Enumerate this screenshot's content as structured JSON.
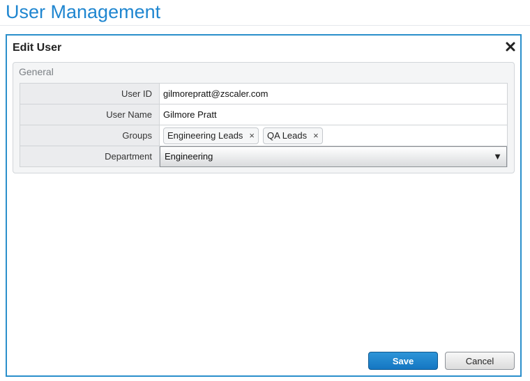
{
  "page": {
    "title": "User Management"
  },
  "dialog": {
    "title": "Edit User",
    "close_icon": "close-x-icon",
    "section": {
      "title": "General",
      "fields": {
        "user_id": {
          "label": "User ID",
          "value": "gilmorepratt@zscaler.com"
        },
        "user_name": {
          "label": "User Name",
          "value": "Gilmore Pratt"
        },
        "groups": {
          "label": "Groups",
          "tags": [
            "Engineering Leads",
            "QA Leads"
          ],
          "remove_glyph": "×"
        },
        "department": {
          "label": "Department",
          "selected": "Engineering",
          "caret_glyph": "▼"
        }
      }
    },
    "buttons": {
      "save_label": "Save",
      "cancel_label": "Cancel"
    }
  },
  "colors": {
    "accent": "#1f86d0",
    "dialog_border": "#2a8fcb",
    "save_button": "#1a82cc"
  }
}
